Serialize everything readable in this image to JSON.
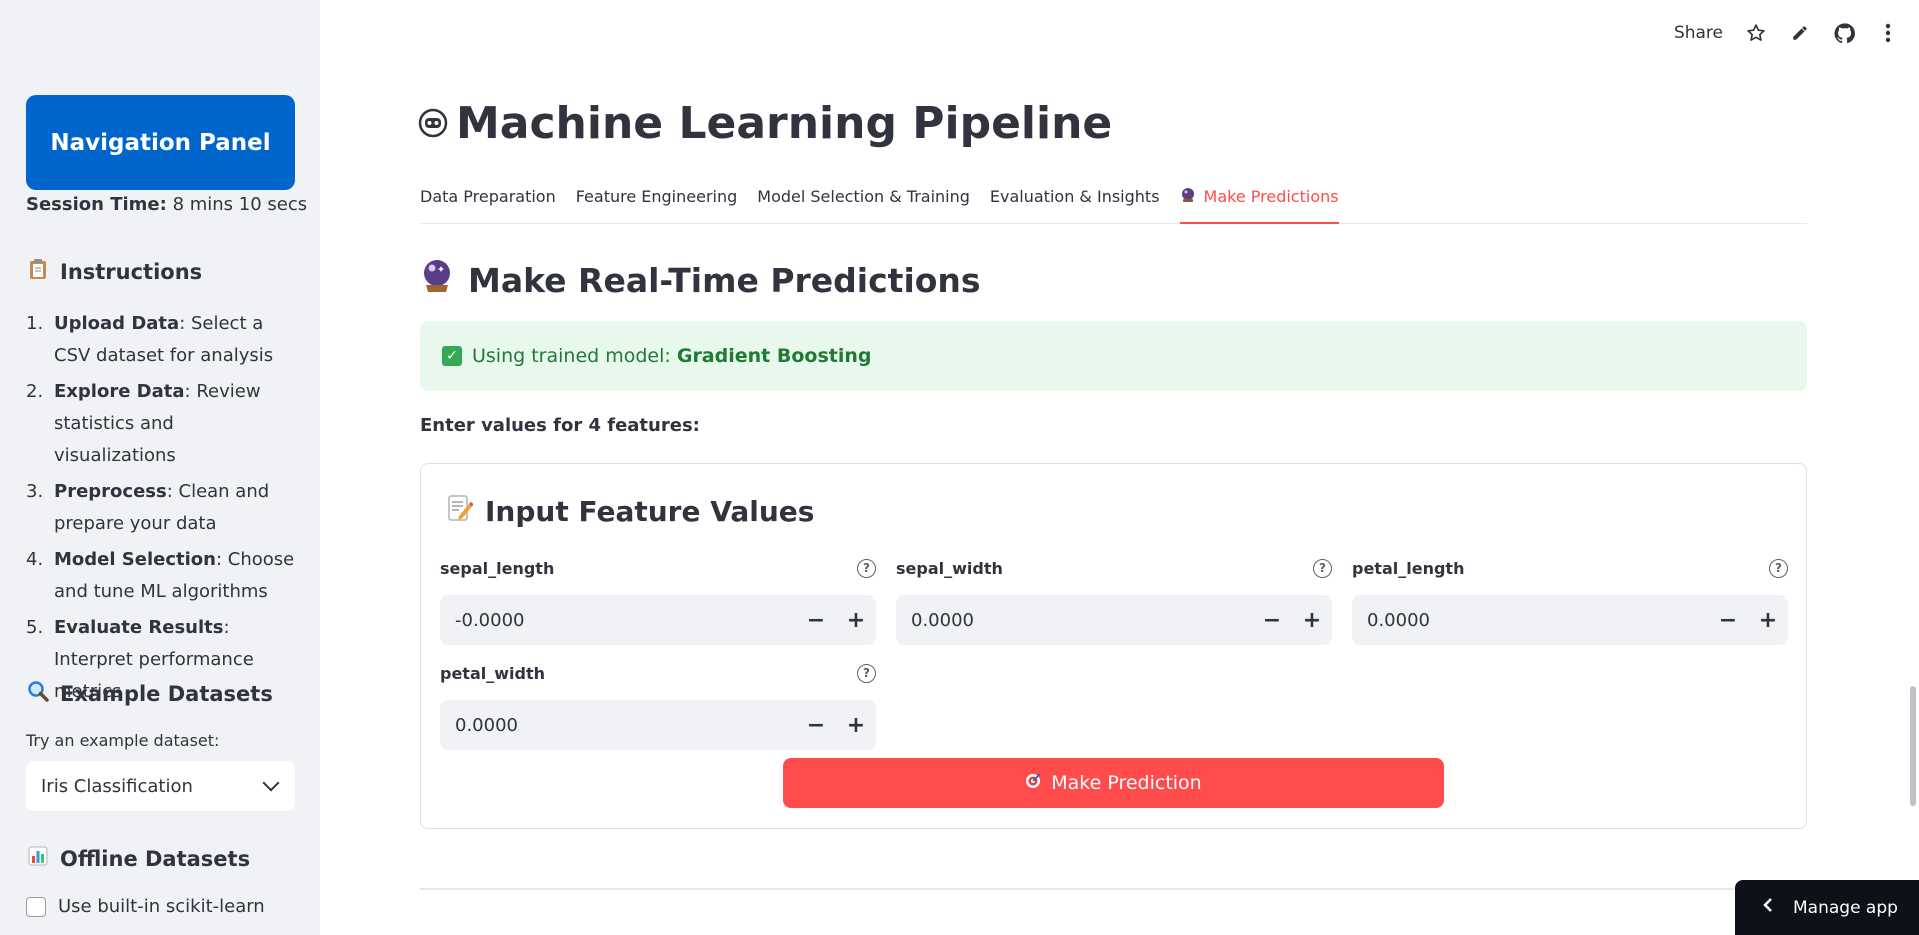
{
  "sidebar": {
    "nav_title": "Navigation Panel",
    "session_label": "Session Time:",
    "session_value": "8 mins 10 secs",
    "instructions_heading": "Instructions",
    "instructions": [
      {
        "num": "1.",
        "bold": "Upload Data",
        "text": ": Select a CSV dataset for analysis"
      },
      {
        "num": "2.",
        "bold": "Explore Data",
        "text": ": Review statistics and visualizations"
      },
      {
        "num": "3.",
        "bold": "Preprocess",
        "text": ": Clean and prepare your data"
      },
      {
        "num": "4.",
        "bold": "Model Selection",
        "text": ": Choose and tune ML algorithms"
      },
      {
        "num": "5.",
        "bold": "Evaluate Results",
        "text": ": Interpret performance metrics"
      }
    ],
    "examples_heading": "Example Datasets",
    "try_label": "Try an example dataset:",
    "selected_dataset": "Iris Classification",
    "offline_heading": "Offline Datasets",
    "offline_checkbox": "Use built-in scikit-learn"
  },
  "toolbar": {
    "share": "Share"
  },
  "main": {
    "title": "Machine Learning Pipeline",
    "tabs": [
      {
        "label": "Data Preparation"
      },
      {
        "label": "Feature Engineering"
      },
      {
        "label": "Model Selection & Training"
      },
      {
        "label": "Evaluation & Insights"
      },
      {
        "label": "Make Predictions"
      }
    ],
    "section_title": "Make Real-Time Predictions",
    "alert_prefix": "Using trained model: ",
    "alert_model": "Gradient Boosting",
    "enter_label": "Enter values for 4 features:",
    "card_title": "Input Feature Values",
    "fields": [
      {
        "label": "sepal_length",
        "value": "-0.0000"
      },
      {
        "label": "sepal_width",
        "value": "0.0000"
      },
      {
        "label": "petal_length",
        "value": "0.0000"
      },
      {
        "label": "petal_width",
        "value": "0.0000"
      }
    ],
    "predict_button": "Make Prediction"
  },
  "manage_app": "Manage app",
  "colors": {
    "accent": "#ff4b4b",
    "nav_blue": "#0066cc",
    "success_bg": "#e9f8ec",
    "success_text": "#1f7a35"
  }
}
